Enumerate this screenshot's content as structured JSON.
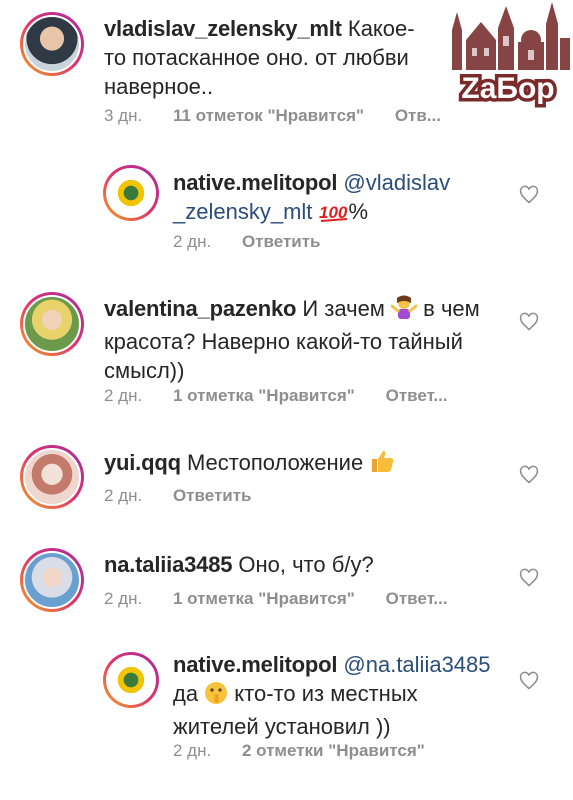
{
  "watermark": {
    "text": "ZаБор"
  },
  "comments": [
    {
      "username": "vladislav_zelensky_mlt",
      "body": " Какое-то потасканное оно. от любви наверное..",
      "time": "3 дн.",
      "likes": "11 отметок \"Нравится\"",
      "reply": "Отв..."
    },
    {
      "username": "native.melitopol",
      "mention": "@vladislav _zelensky_mlt",
      "mention_line1": "@vladislav",
      "mention_line2": "_zelensky_mlt",
      "body_after": "%",
      "emoji": "100",
      "time": "2 дн.",
      "reply": "Ответить"
    },
    {
      "username": "valentina_pazenko",
      "body_before": " И зачем ",
      "body_after": " в чем красота? Наверно какой-то тайный смысл))",
      "line1_after": " в чем",
      "line2": "красота? Наверно какой-то тайный",
      "line3": "смысл))",
      "emoji": "person-shrugging",
      "time": "2 дн.",
      "likes": "1 отметка \"Нравится\"",
      "reply": "Ответ..."
    },
    {
      "username": "yui.qqq",
      "body": " Местоположение ",
      "emoji": "thumbs-up",
      "time": "2 дн.",
      "reply": "Ответить"
    },
    {
      "username": "na.taliia3485",
      "body": " Оно, что б/у?",
      "time": "2 дн.",
      "likes": "1 отметка \"Нравится\"",
      "reply": "Ответ..."
    },
    {
      "username": "native.melitopol",
      "mention": "@na.taliia3485",
      "line2_before": "да ",
      "line2_after": " кто-то из местных",
      "line3": "жителей установил ))",
      "emoji": "shushing-face",
      "time": "2 дн.",
      "likes": "2 отметки \"Нравится\""
    }
  ],
  "icons": {
    "like": "heart-outline-icon"
  },
  "colors": {
    "text": "#262626",
    "meta": "#8e8e8e",
    "mention": "#2a4d7a",
    "logo": "#7a2a2a"
  }
}
